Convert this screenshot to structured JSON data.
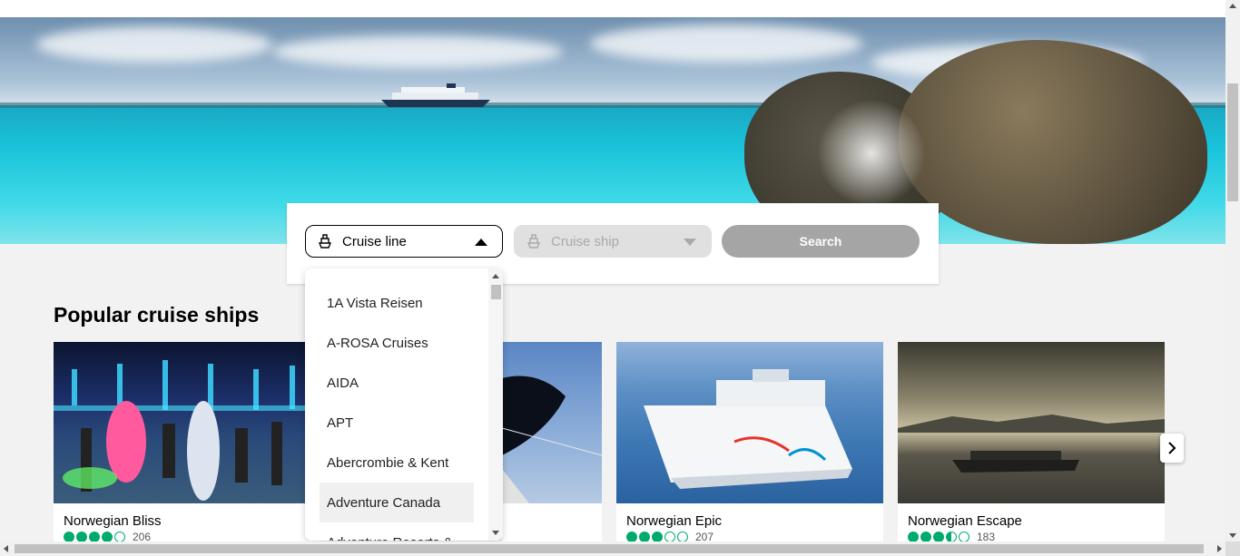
{
  "search": {
    "cruise_line_label": "Cruise line",
    "cruise_ship_label": "Cruise ship",
    "search_button": "Search"
  },
  "dropdown": {
    "options": [
      "1A Vista Reisen",
      "A-ROSA Cruises",
      "AIDA",
      "APT",
      "Abercrombie & Kent",
      "Adventure Canada",
      "Adventure Resorts &"
    ],
    "highlighted": "Adventure Canada"
  },
  "section": {
    "title": "Popular cruise ships"
  },
  "cards": [
    {
      "name": "Norwegian Bliss",
      "rating": 4,
      "count": "206"
    },
    {
      "name": "",
      "rating": 0,
      "count": ""
    },
    {
      "name": "Norwegian Epic",
      "rating": 3,
      "count": "207"
    },
    {
      "name": "Norwegian Escape",
      "rating": 3.5,
      "count": "183"
    }
  ],
  "colors": {
    "rating_green": "#00aa6c",
    "search_button_bg": "#a5a5a5"
  },
  "icons": {
    "cruise_line": "ship-icon",
    "cruise_ship": "ship-icon",
    "next": "chevron-right-icon"
  }
}
